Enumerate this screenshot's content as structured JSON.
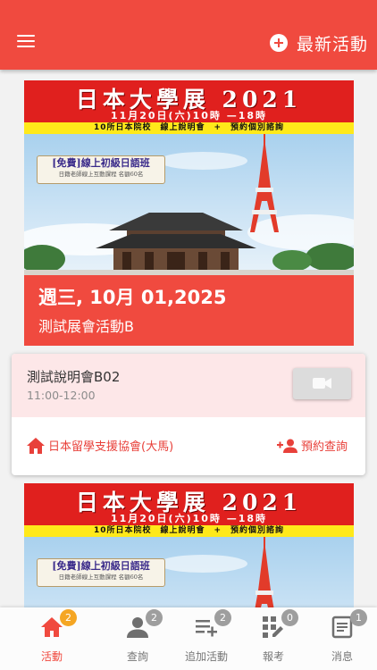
{
  "header": {
    "menu_icon": "hamburger-menu-icon",
    "add_icon": "plus-circle-icon",
    "action_label": "最新活動"
  },
  "posters": [
    {
      "title": "日本大學展 2021",
      "date_line": "11月20日(六)10時 —18時",
      "strip": "10所日本院校　線上說明會　+　預約個別諮詢",
      "scroll_main": "[免費]線上初級日語班",
      "scroll_sub": "日籍老師線上互動課程 名額60名"
    },
    {
      "title": "日本大學展 2021",
      "date_line": "11月20日(六)10時 —18時",
      "strip": "10所日本院校　線上說明會　+　預約個別諮詢",
      "scroll_main": "[免費]線上初級日語班",
      "scroll_sub": "日籍老師線上互動課程 名額60名"
    }
  ],
  "event": {
    "date": "週三, 10月 01,2025",
    "name": "測試展會活動B"
  },
  "session": {
    "title": "測試說明會B02",
    "time": "11:00-12:00",
    "video_icon": "video-camera-icon",
    "organizer": "日本留學支援協會(大馬)",
    "organizer_icon": "home-icon",
    "booking_label": "預約查詢",
    "booking_icon": "add-person-icon"
  },
  "nav": {
    "items": [
      {
        "label": "活動",
        "badge": "2",
        "icon": "home-icon",
        "active": true
      },
      {
        "label": "查詢",
        "badge": "2",
        "icon": "person-icon",
        "active": false
      },
      {
        "label": "追加活動",
        "badge": "2",
        "icon": "playlist-add-icon",
        "active": false
      },
      {
        "label": "報考",
        "badge": "0",
        "icon": "grid-edit-icon",
        "active": false
      },
      {
        "label": "消息",
        "badge": "1",
        "icon": "document-icon",
        "active": false
      }
    ]
  },
  "colors": {
    "primary": "#f04a3f",
    "poster_red": "#e0201e",
    "poster_yellow": "#ffe91a",
    "session_bg": "#fde7e8",
    "badge_active": "#f5a623",
    "badge_inactive": "#9e9e9e"
  }
}
